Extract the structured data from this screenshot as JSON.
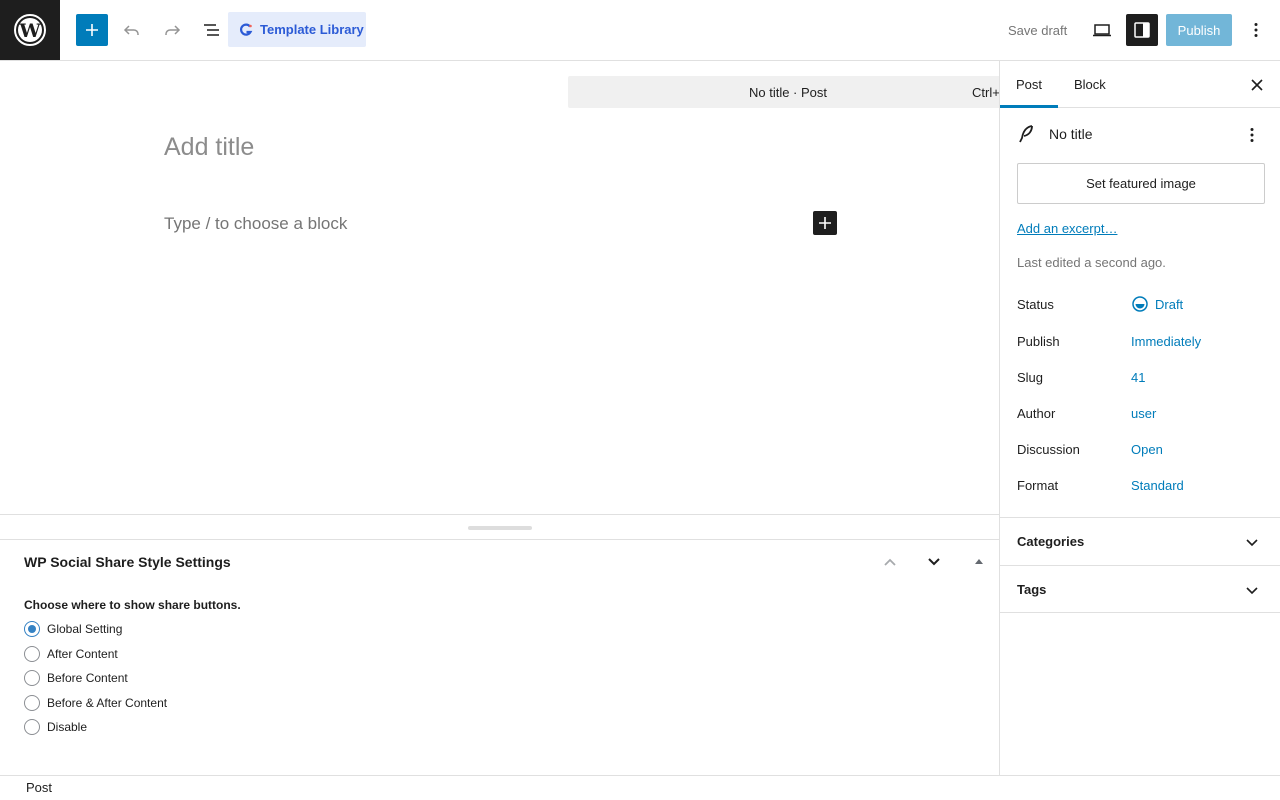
{
  "toolbar": {
    "template_library_label": "Template Library",
    "save_draft_label": "Save draft",
    "publish_label": "Publish"
  },
  "canvas": {
    "document_bar_title": "No title · Post",
    "document_bar_shortcut": "Ctrl+K",
    "title_placeholder": "Add title",
    "block_placeholder": "Type / to choose a block"
  },
  "metabox": {
    "title": "WP Social Share Style Settings",
    "prompt": "Choose where to show share buttons.",
    "options": [
      {
        "label": "Global Setting",
        "checked": true
      },
      {
        "label": "After Content",
        "checked": false
      },
      {
        "label": "Before Content",
        "checked": false
      },
      {
        "label": "Before & After Content",
        "checked": false
      },
      {
        "label": "Disable",
        "checked": false
      }
    ]
  },
  "footer": {
    "breadcrumb": "Post"
  },
  "sidebar": {
    "tabs": [
      {
        "label": "Post",
        "active": true
      },
      {
        "label": "Block",
        "active": false
      }
    ],
    "post_title": "No title",
    "featured_image_label": "Set featured image",
    "excerpt_link": "Add an excerpt…",
    "last_edited": "Last edited a second ago.",
    "properties": [
      {
        "key": "Status",
        "value": "Draft",
        "icon": "draft-status-icon"
      },
      {
        "key": "Publish",
        "value": "Immediately"
      },
      {
        "key": "Slug",
        "value": "41"
      },
      {
        "key": "Author",
        "value": "user"
      },
      {
        "key": "Discussion",
        "value": "Open"
      },
      {
        "key": "Format",
        "value": "Standard"
      }
    ],
    "panels": [
      {
        "label": "Categories"
      },
      {
        "label": "Tags"
      }
    ]
  },
  "colors": {
    "accent": "#007cba",
    "dark": "#1e1e1e",
    "template_library_bg": "#e5ecfb",
    "template_library_text": "#2c5bd6"
  }
}
